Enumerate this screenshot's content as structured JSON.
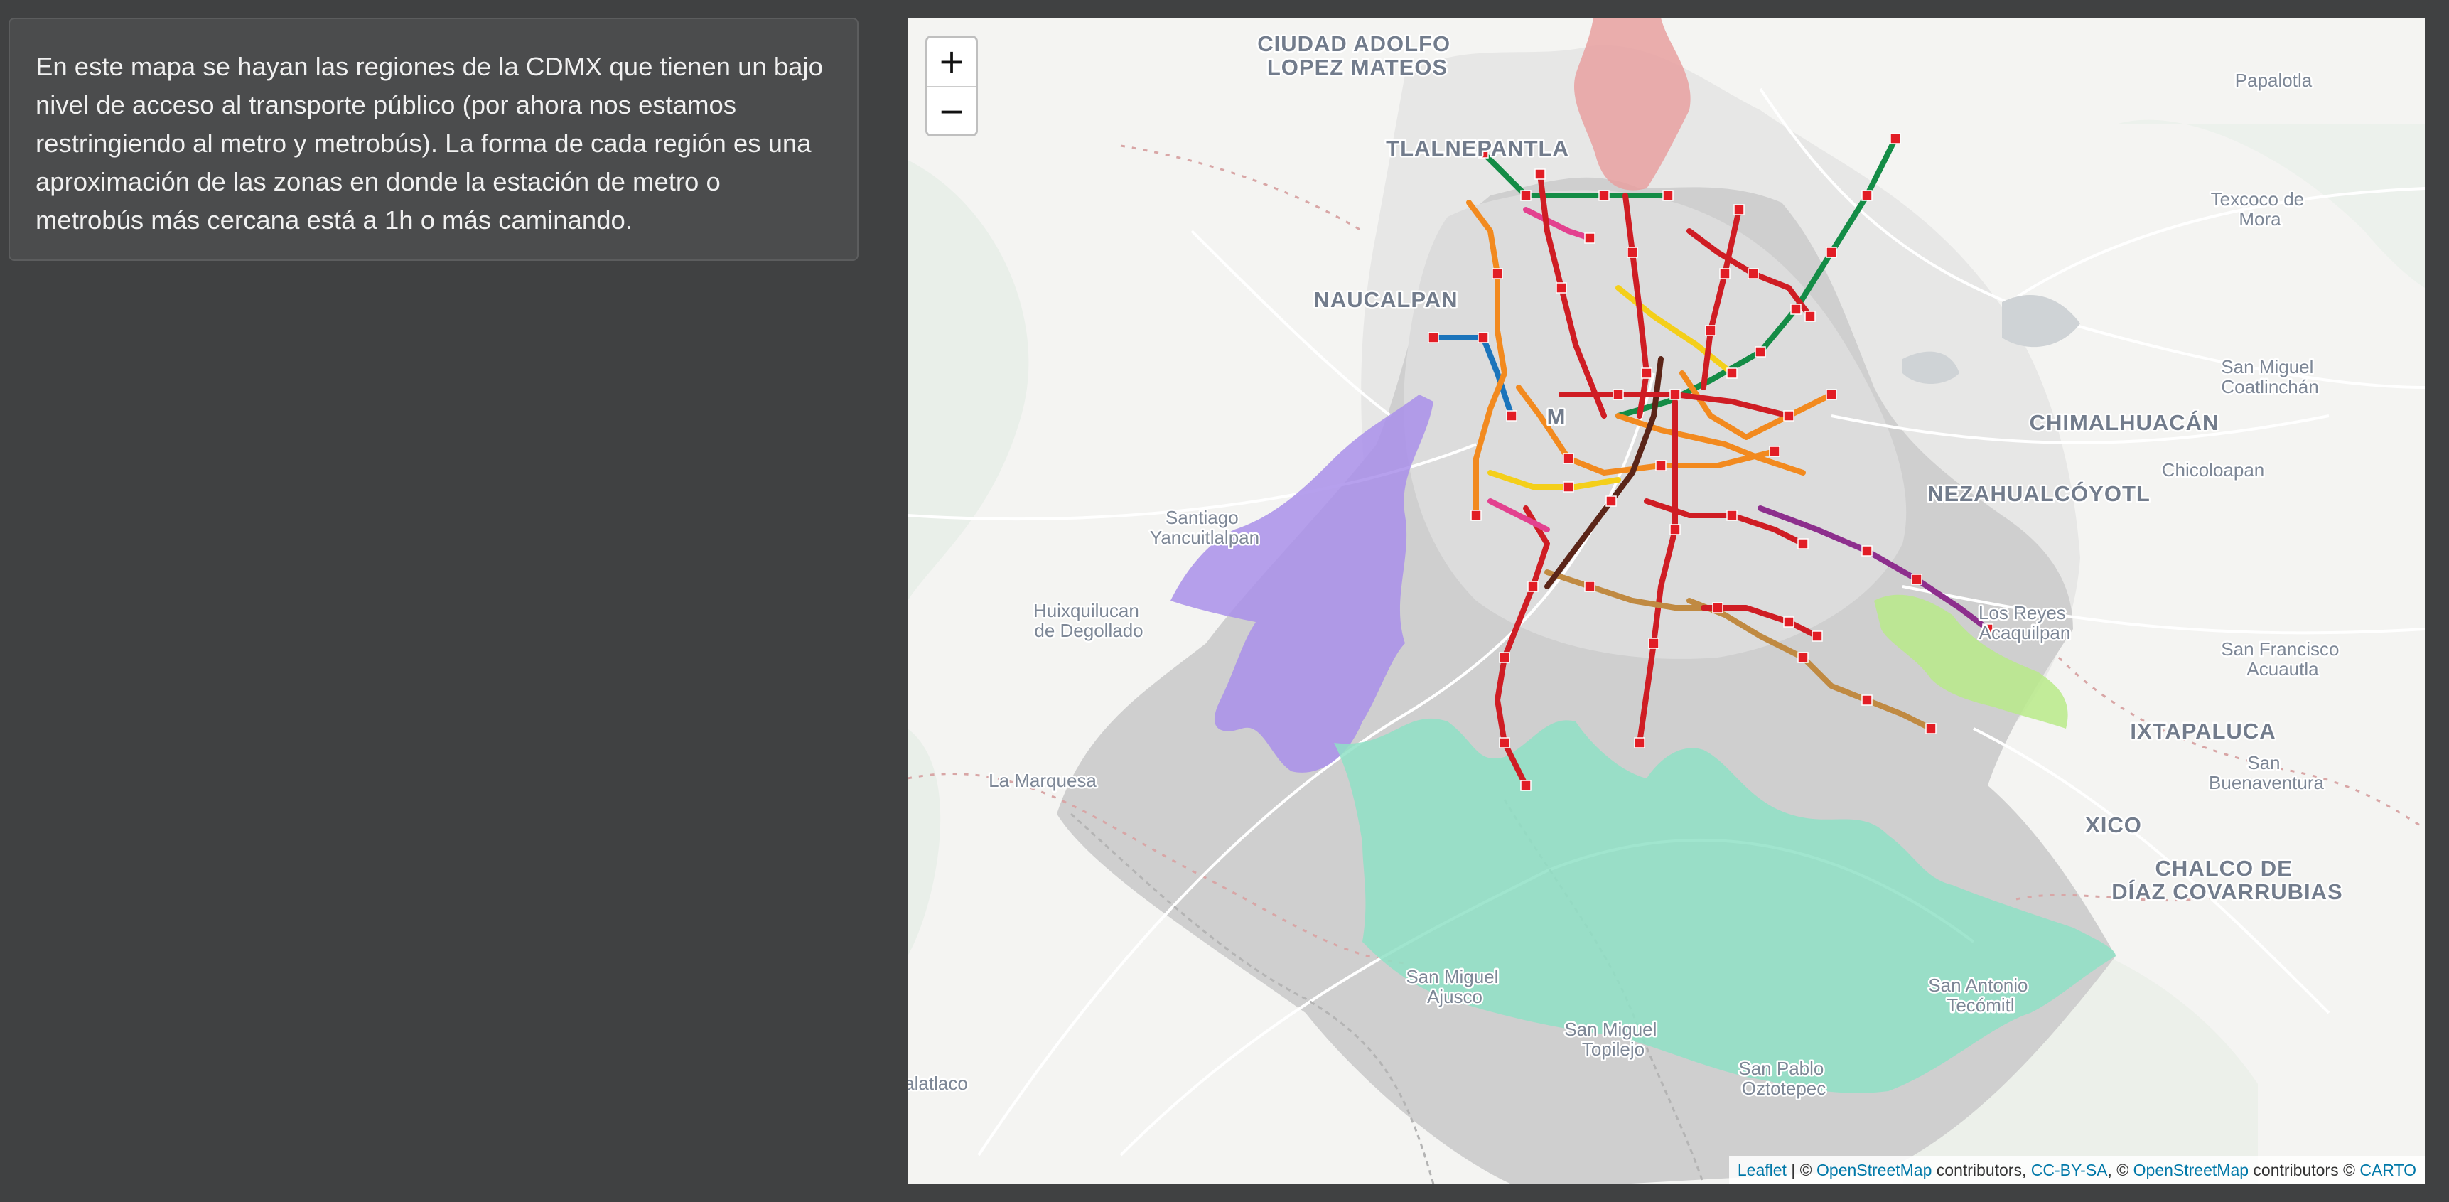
{
  "info": {
    "text": "En este mapa se hayan las regiones de la CDMX que tienen un bajo nivel de acceso al transporte público (por ahora nos estamos restringiendo al metro y metrobús). La forma de cada región es una aproximación de las zonas en donde la estación de metro o metrobús más cercana está a 1h o más caminando."
  },
  "map": {
    "zoom_in_label": "+",
    "zoom_out_label": "−",
    "attribution": {
      "leaflet": "Leaflet",
      "sep1": " | © ",
      "osm1": "OpenStreetMap",
      "contrib1": " contributors, ",
      "ccbysa": "CC-BY-SA",
      "sep2": ", © ",
      "osm2": "OpenStreetMap",
      "contrib2": " contributors © ",
      "carto": "CARTO"
    },
    "labels": {
      "ciudad_adolfo": [
        "CIUDAD ADOLFO",
        "LOPEZ MATEOS"
      ],
      "tlalnepantla": "TLALNEPANTLA",
      "naucalpan": "NAUCALPAN",
      "santiago": [
        "Santiago",
        "Yancuitlalpan"
      ],
      "huixquilucan": [
        "Huixquilucan",
        "de Degollado"
      ],
      "la_marquesa": "La Marquesa",
      "palatlaco": "alatlaco",
      "papalotla": "Papalotla",
      "texcoco": [
        "Texcoco de",
        "Mora"
      ],
      "san_miguel_coatlinchan": [
        "San Miguel",
        "Coatlinchán"
      ],
      "chimalhuacan": "CHIMALHUACÁN",
      "chicoloapan": "Chicoloapan",
      "nezahualcoyotl": "NEZAHUALCÓYOTL",
      "los_reyes": [
        "Los Reyes",
        "Acaquilpan"
      ],
      "san_francisco": [
        "San Francisco",
        "Acuautla"
      ],
      "ixtapaluca": "IXTAPALUCA",
      "san_buenaventura": [
        "San",
        "Buenaventura"
      ],
      "xico": "XICO",
      "chalco": [
        "CHALCO DE",
        "DÍAZ COVARRUBIAS"
      ],
      "san_miguel_ajusco": [
        "San Miguel",
        "Ajusco"
      ],
      "san_miguel_topilejo": [
        "San Miguel",
        "Topilejo"
      ],
      "san_antonio": [
        "San Antonio",
        "Tecómitl"
      ],
      "san_pablo": [
        "San Pablo",
        "Oztotepec"
      ],
      "mexico": "M"
    },
    "colors": {
      "cdmx_area": "#c9c9c9",
      "urban_area": "#d9d9d9",
      "region_north": "#e8a0a0",
      "region_west": "#a98fea",
      "region_south": "#8fe0c6",
      "region_east": "#b9ea8a",
      "stop_marker": "#e21d25",
      "line_pink": "#e3418f",
      "line_blue": "#1b74bb",
      "line_green": "#148c46",
      "line_orange": "#f28a1f",
      "line_purple": "#8d2f8d",
      "line_red": "#cf1d24",
      "line_brown": "#c08a42",
      "line_yellow": "#f4cf1a",
      "line_dark": "#5b2518"
    }
  }
}
